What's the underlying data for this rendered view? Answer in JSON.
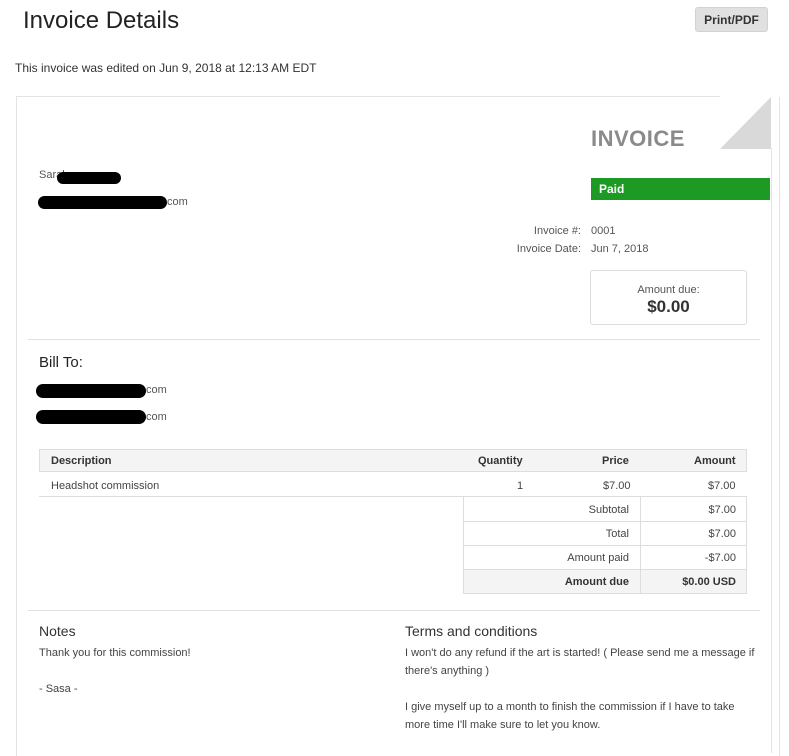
{
  "header": {
    "title": "Invoice Details",
    "print_label": "Print/PDF",
    "edited_note": "This invoice was edited on Jun 9, 2018 at 12:13 AM EDT"
  },
  "invoice": {
    "heading": "INVOICE",
    "status": "Paid",
    "status_color": "#1d9a24",
    "sender_name_visible": "Sarah",
    "sender_email_tail": "com",
    "number_label": "Invoice #:",
    "number": "0001",
    "date_label": "Invoice Date:",
    "date": "Jun 7, 2018",
    "amount_due_label": "Amount due:",
    "amount_due": "$0.00"
  },
  "bill_to": {
    "label": "Bill To:",
    "line1_tail": "com",
    "line2_tail": "com"
  },
  "items": {
    "headers": {
      "description": "Description",
      "quantity": "Quantity",
      "price": "Price",
      "amount": "Amount"
    },
    "rows": [
      {
        "description": "Headshot commission",
        "quantity": "1",
        "price": "$7.00",
        "amount": "$7.00"
      }
    ]
  },
  "totals": {
    "subtotal_label": "Subtotal",
    "subtotal": "$7.00",
    "total_label": "Total",
    "total": "$7.00",
    "paid_label": "Amount paid",
    "paid": "-$7.00",
    "due_label": "Amount due",
    "due": "$0.00 USD"
  },
  "notes": {
    "label": "Notes",
    "line1": "Thank you for this commission!",
    "line2": "- Sasa -"
  },
  "terms": {
    "label": "Terms and conditions",
    "para1": "I won't do any refund if the art is started! ( Please send me a message if there's anything )",
    "para2": "I give myself up to a month to finish the commission if I have to take more time I'll make sure to let you know."
  }
}
